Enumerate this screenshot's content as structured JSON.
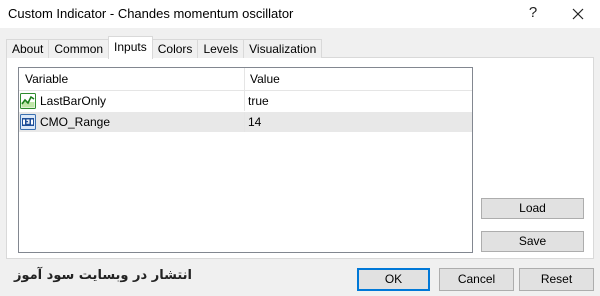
{
  "window": {
    "title": "Custom Indicator - Chandes momentum oscillator",
    "help_label": "?",
    "close_icon": "close-icon"
  },
  "tabs": [
    {
      "label": "About",
      "active": false
    },
    {
      "label": "Common",
      "active": false
    },
    {
      "label": "Inputs",
      "active": true
    },
    {
      "label": "Colors",
      "active": false
    },
    {
      "label": "Levels",
      "active": false
    },
    {
      "label": "Visualization",
      "active": false
    }
  ],
  "inputs_table": {
    "columns": [
      "Variable",
      "Value"
    ],
    "rows": [
      {
        "icon": "bool-chart-icon",
        "variable": "LastBarOnly",
        "value": "true",
        "selected": false
      },
      {
        "icon": "integer-123-icon",
        "variable": "CMO_Range",
        "value": "14",
        "selected": true
      }
    ]
  },
  "side_buttons": {
    "load": "Load",
    "save": "Save"
  },
  "footer": {
    "watermark": "انتشار در وبسایت سود آموز",
    "ok": "OK",
    "cancel": "Cancel",
    "reset": "Reset"
  },
  "colors": {
    "default_button_border": "#0078d7",
    "selected_row": "#e8e8e8"
  }
}
